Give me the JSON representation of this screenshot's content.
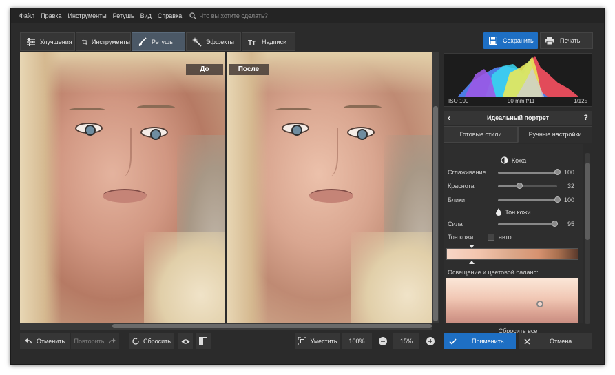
{
  "menu": {
    "items": [
      "Файл",
      "Правка",
      "Инструменты",
      "Ретушь",
      "Вид",
      "Справка"
    ],
    "search_placeholder": "Что вы хотите сделать?"
  },
  "toolbar": {
    "tabs": [
      {
        "label": "Улучшения",
        "icon": "sliders-icon"
      },
      {
        "label": "Инструменты",
        "icon": "crop-icon"
      },
      {
        "label": "Ретушь",
        "icon": "brush-icon",
        "active": true
      },
      {
        "label": "Эффекты",
        "icon": "magic-wand-icon"
      },
      {
        "label": "Надписи",
        "icon": "text-icon"
      }
    ],
    "save_label": "Сохранить",
    "print_label": "Печать"
  },
  "preview": {
    "before_label": "До",
    "after_label": "После"
  },
  "bottombar": {
    "undo_label": "Отменить",
    "redo_label": "Повторить",
    "reset_label": "Сбросить",
    "fit_label": "Уместить",
    "zoom_100_label": "100%",
    "zoom_value": "15%",
    "apply_label": "Применить",
    "cancel_label": "Отмена"
  },
  "histogram": {
    "iso": "ISO 100",
    "lens": "90 mm f/11",
    "shutter": "1/125"
  },
  "panel": {
    "title": "Идеальный портрет",
    "tab_presets": "Готовые стили",
    "tab_manual": "Ручные настройки",
    "section_skin": "Кожа",
    "smoothing_label": "Сглаживание",
    "smoothing_value": "100",
    "redness_label": "Краснота",
    "redness_value": "32",
    "shine_label": "Блики",
    "shine_value": "100",
    "section_tone": "Тон кожи",
    "strength_label": "Сила",
    "strength_value": "95",
    "tone_label": "Тон кожи",
    "auto_label": "авто",
    "light_label": "Освещение и цветовой баланс:",
    "reset_all": "Сбросить все"
  },
  "colors": {
    "accent": "#1e6fc4",
    "background": "#2b2b2b",
    "active_tab": "#4b5866"
  }
}
